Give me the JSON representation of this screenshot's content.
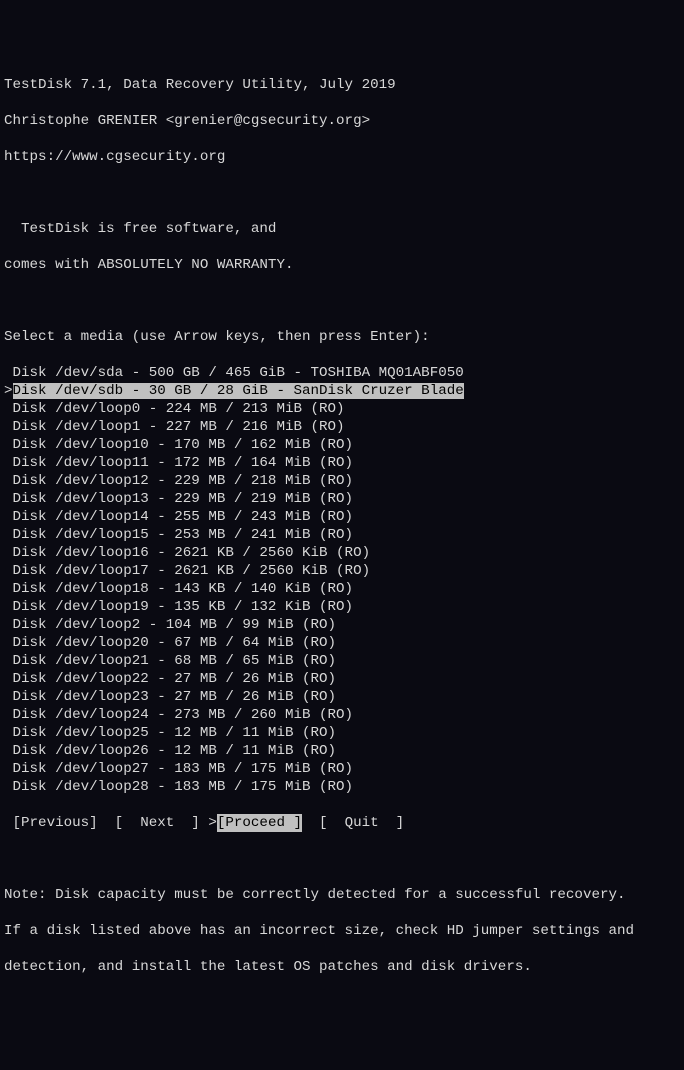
{
  "header": {
    "line1": "TestDisk 7.1, Data Recovery Utility, July 2019",
    "line2": "Christophe GRENIER <grenier@cgsecurity.org>",
    "line3": "https://www.cgsecurity.org"
  },
  "intro": {
    "line1": "  TestDisk is free software, and",
    "line2": "comes with ABSOLUTELY NO WARRANTY."
  },
  "prompt": "Select a media (use Arrow keys, then press Enter):",
  "disks": [
    {
      "text": " Disk /dev/sda - 500 GB / 465 GiB - TOSHIBA MQ01ABF050",
      "selected": false
    },
    {
      "text": "Disk /dev/sdb - 30 GB / 28 GiB - SanDisk Cruzer Blade",
      "selected": true
    },
    {
      "text": " Disk /dev/loop0 - 224 MB / 213 MiB (RO)",
      "selected": false
    },
    {
      "text": " Disk /dev/loop1 - 227 MB / 216 MiB (RO)",
      "selected": false
    },
    {
      "text": " Disk /dev/loop10 - 170 MB / 162 MiB (RO)",
      "selected": false
    },
    {
      "text": " Disk /dev/loop11 - 172 MB / 164 MiB (RO)",
      "selected": false
    },
    {
      "text": " Disk /dev/loop12 - 229 MB / 218 MiB (RO)",
      "selected": false
    },
    {
      "text": " Disk /dev/loop13 - 229 MB / 219 MiB (RO)",
      "selected": false
    },
    {
      "text": " Disk /dev/loop14 - 255 MB / 243 MiB (RO)",
      "selected": false
    },
    {
      "text": " Disk /dev/loop15 - 253 MB / 241 MiB (RO)",
      "selected": false
    },
    {
      "text": " Disk /dev/loop16 - 2621 KB / 2560 KiB (RO)",
      "selected": false
    },
    {
      "text": " Disk /dev/loop17 - 2621 KB / 2560 KiB (RO)",
      "selected": false
    },
    {
      "text": " Disk /dev/loop18 - 143 KB / 140 KiB (RO)",
      "selected": false
    },
    {
      "text": " Disk /dev/loop19 - 135 KB / 132 KiB (RO)",
      "selected": false
    },
    {
      "text": " Disk /dev/loop2 - 104 MB / 99 MiB (RO)",
      "selected": false
    },
    {
      "text": " Disk /dev/loop20 - 67 MB / 64 MiB (RO)",
      "selected": false
    },
    {
      "text": " Disk /dev/loop21 - 68 MB / 65 MiB (RO)",
      "selected": false
    },
    {
      "text": " Disk /dev/loop22 - 27 MB / 26 MiB (RO)",
      "selected": false
    },
    {
      "text": " Disk /dev/loop23 - 27 MB / 26 MiB (RO)",
      "selected": false
    },
    {
      "text": " Disk /dev/loop24 - 273 MB / 260 MiB (RO)",
      "selected": false
    },
    {
      "text": " Disk /dev/loop25 - 12 MB / 11 MiB (RO)",
      "selected": false
    },
    {
      "text": " Disk /dev/loop26 - 12 MB / 11 MiB (RO)",
      "selected": false
    },
    {
      "text": " Disk /dev/loop27 - 183 MB / 175 MiB (RO)",
      "selected": false
    },
    {
      "text": " Disk /dev/loop28 - 183 MB / 175 MiB (RO)",
      "selected": false
    }
  ],
  "menu": {
    "previous": " [Previous] ",
    "next": " [  Next  ] ",
    "proceed_prefix": ">",
    "proceed": "[Proceed ]",
    "quit": "  [  Quit  ]"
  },
  "note": {
    "line1": "Note: Disk capacity must be correctly detected for a successful recovery.",
    "line2": "If a disk listed above has an incorrect size, check HD jumper settings and",
    "line3": "detection, and install the latest OS patches and disk drivers."
  }
}
